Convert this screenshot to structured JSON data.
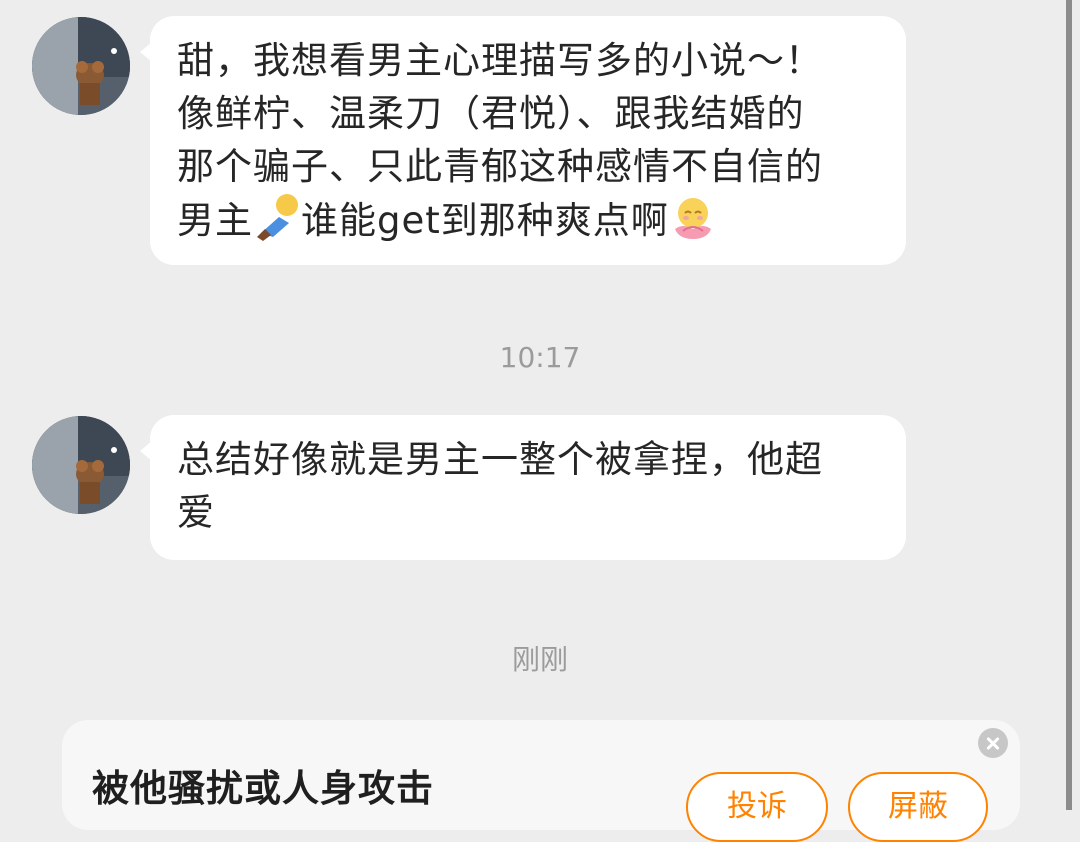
{
  "messages": [
    {
      "text_lines": [
        "甜，我想看男主心理描写多的小说～！",
        "像鲜柠、温柔刀（君悦）、跟我结婚的",
        "那个骗子、只此青郁这种感情不自信的"
      ],
      "last_line_start": "男主",
      "emoji_1": "lying-down-person-emoji",
      "last_line_middle": "谁能get到那种爽点啊",
      "emoji_2": "lotus-smiley-emoji"
    },
    {
      "text_lines": [
        "总结好像就是男主一整个被拿捏，他超",
        "爱"
      ]
    }
  ],
  "timestamps": {
    "first": "10:17",
    "second": "刚刚"
  },
  "harass_card": {
    "title": "被他骚扰或人身攻击",
    "report_label": "投诉",
    "block_label": "屏蔽"
  },
  "colors": {
    "background": "#ededed",
    "bubble": "#ffffff",
    "accent_orange": "#ff8200",
    "timestamp": "#9b9b9b"
  }
}
